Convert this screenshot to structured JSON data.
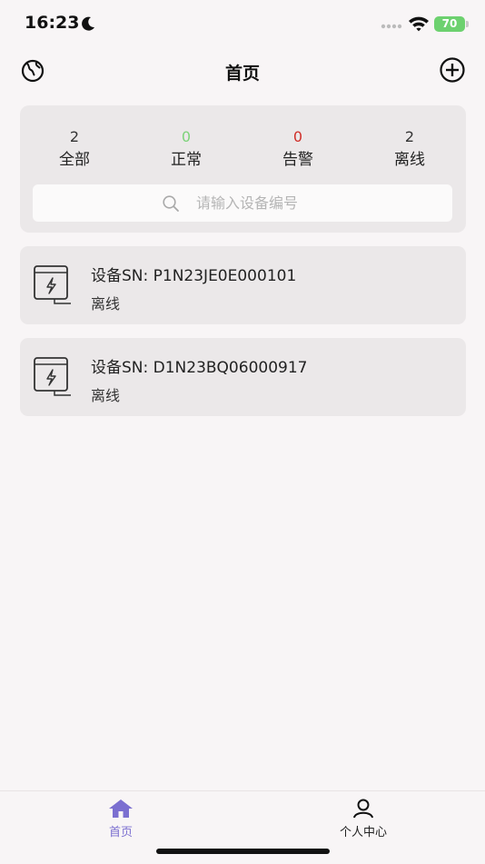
{
  "status_bar": {
    "time": "16:23",
    "battery": "70"
  },
  "nav": {
    "title": "首页"
  },
  "summary": {
    "stats": [
      {
        "count": "2",
        "label": "全部",
        "color": "#333333"
      },
      {
        "count": "0",
        "label": "正常",
        "color": "#7dd37a"
      },
      {
        "count": "0",
        "label": "告警",
        "color": "#d0302a"
      },
      {
        "count": "2",
        "label": "离线",
        "color": "#333333"
      }
    ],
    "search_placeholder": "请输入设备编号"
  },
  "devices": [
    {
      "sn": "设备SN: P1N23JE0E000101",
      "status": "离线"
    },
    {
      "sn": "设备SN: D1N23BQ06000917",
      "status": "离线"
    }
  ],
  "tabbar": {
    "tabs": [
      {
        "label": "首页",
        "active": true,
        "color": "#7b6fd0"
      },
      {
        "label": "个人中心",
        "active": false,
        "color": "#222222"
      }
    ]
  }
}
